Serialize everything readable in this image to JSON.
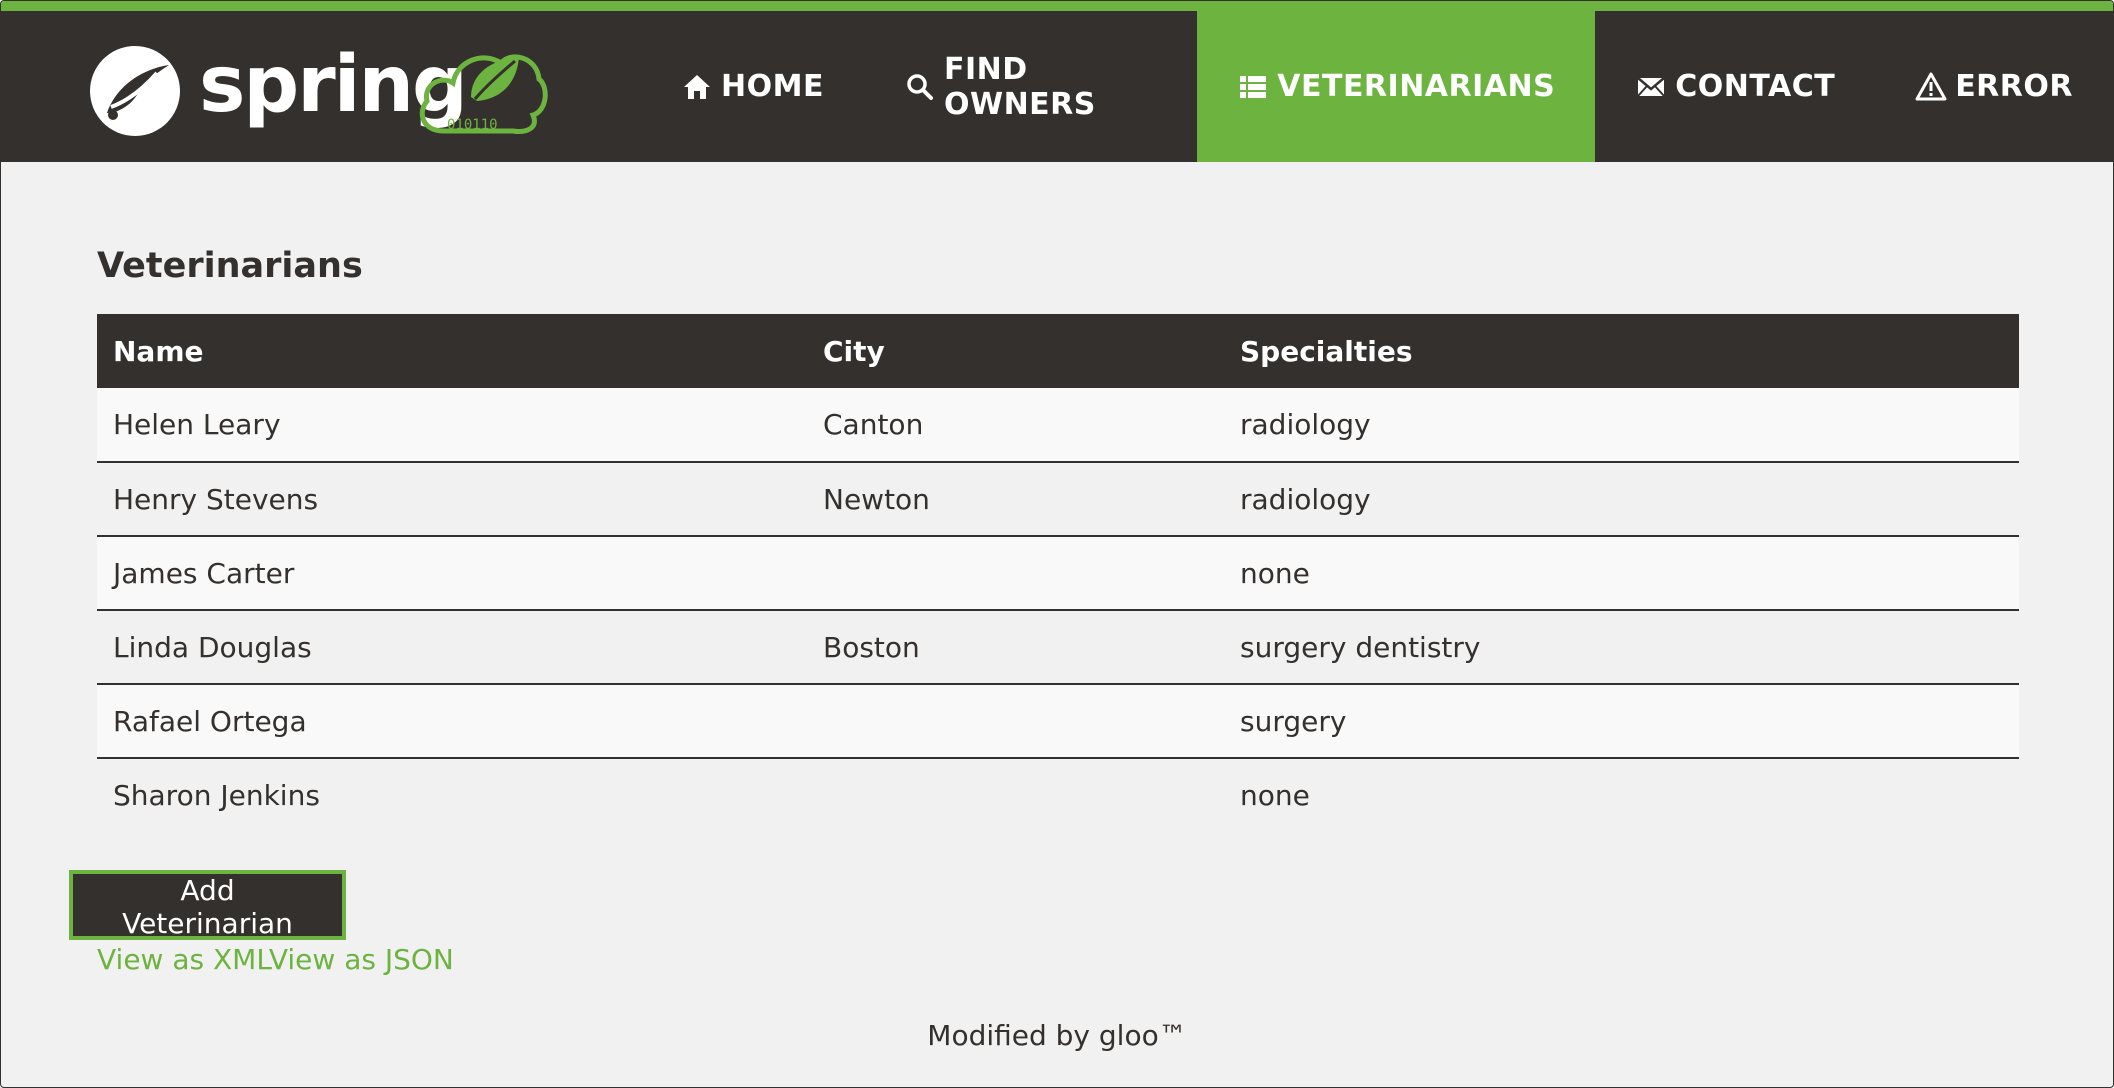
{
  "brand": {
    "logo_text": "spring",
    "cloud_text": "010110"
  },
  "nav": {
    "items": [
      {
        "label": "HOME",
        "icon": "home-icon"
      },
      {
        "label": "FIND OWNERS",
        "icon": "search-icon"
      },
      {
        "label": "VETERINARIANS",
        "icon": "list-icon",
        "active": true
      },
      {
        "label": "CONTACT",
        "icon": "envelope-icon"
      },
      {
        "label": "ERROR",
        "icon": "warning-icon"
      }
    ]
  },
  "page": {
    "title": "Veterinarians"
  },
  "table": {
    "headers": [
      "Name",
      "City",
      "Specialties"
    ],
    "rows": [
      [
        "Helen Leary",
        "Canton",
        "radiology"
      ],
      [
        "Henry Stevens",
        "Newton",
        "radiology"
      ],
      [
        "James Carter",
        "",
        "none"
      ],
      [
        "Linda Douglas",
        "Boston",
        "surgery dentistry"
      ],
      [
        "Rafael Ortega",
        "",
        "surgery"
      ],
      [
        "Sharon Jenkins",
        "",
        "none"
      ]
    ]
  },
  "actions": {
    "add_label": "Add Veterinarian",
    "xml_link": "View as XML",
    "json_link": "View as JSON"
  },
  "footer": {
    "text": "Modified by gloo™"
  },
  "colors": {
    "brand_green": "#6db33f",
    "dark": "#34302d",
    "background": "#f1f1f1"
  }
}
